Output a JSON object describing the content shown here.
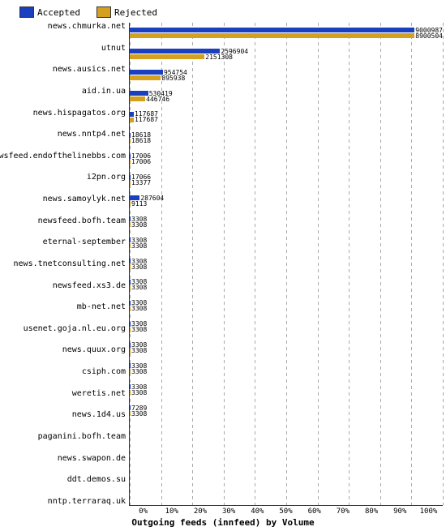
{
  "legend": {
    "accepted_label": "Accepted",
    "rejected_label": "Rejected"
  },
  "x_axis": {
    "title": "Outgoing feeds (innfeed) by Volume",
    "ticks": [
      "0%",
      "10%",
      "20%",
      "30%",
      "40%",
      "50%",
      "60%",
      "70%",
      "80%",
      "90%",
      "100%"
    ]
  },
  "max_value": 9000987,
  "bars": [
    {
      "label": "news.chmurka.net",
      "accepted": 9000987,
      "rejected": 8900504,
      "acc_pct": 100,
      "rej_pct": 98.8
    },
    {
      "label": "utnut",
      "accepted": 2596904,
      "rejected": 2151308,
      "acc_pct": 28.8,
      "rej_pct": 23.9
    },
    {
      "label": "news.ausics.net",
      "accepted": 954754,
      "rejected": 895938,
      "acc_pct": 10.6,
      "rej_pct": 9.95
    },
    {
      "label": "aid.in.ua",
      "accepted": 530419,
      "rejected": 446746,
      "acc_pct": 5.89,
      "rej_pct": 4.96
    },
    {
      "label": "news.hispagatos.org",
      "accepted": 117687,
      "rejected": 117687,
      "acc_pct": 1.31,
      "rej_pct": 1.31
    },
    {
      "label": "news.nntp4.net",
      "accepted": 18618,
      "rejected": 18618,
      "acc_pct": 0.207,
      "rej_pct": 0.207
    },
    {
      "label": "newsfeed.endofthelinebbs.com",
      "accepted": 17006,
      "rejected": 17006,
      "acc_pct": 0.189,
      "rej_pct": 0.189
    },
    {
      "label": "i2pn.org",
      "accepted": 17066,
      "rejected": 13377,
      "acc_pct": 0.19,
      "rej_pct": 0.149
    },
    {
      "label": "news.samoylyk.net",
      "accepted": 287604,
      "rejected": 9113,
      "acc_pct": 3.2,
      "rej_pct": 0.101
    },
    {
      "label": "newsfeed.bofh.team",
      "accepted": 3308,
      "rejected": 3308,
      "acc_pct": 0.0368,
      "rej_pct": 0.0368
    },
    {
      "label": "eternal-september",
      "accepted": 3308,
      "rejected": 3308,
      "acc_pct": 0.0368,
      "rej_pct": 0.0368
    },
    {
      "label": "news.tnetconsulting.net",
      "accepted": 3308,
      "rejected": 3308,
      "acc_pct": 0.0368,
      "rej_pct": 0.0368
    },
    {
      "label": "newsfeed.xs3.de",
      "accepted": 3308,
      "rejected": 3308,
      "acc_pct": 0.0368,
      "rej_pct": 0.0368
    },
    {
      "label": "mb-net.net",
      "accepted": 3308,
      "rejected": 3308,
      "acc_pct": 0.0368,
      "rej_pct": 0.0368
    },
    {
      "label": "usenet.goja.nl.eu.org",
      "accepted": 3308,
      "rejected": 3308,
      "acc_pct": 0.0368,
      "rej_pct": 0.0368
    },
    {
      "label": "news.quux.org",
      "accepted": 3308,
      "rejected": 3308,
      "acc_pct": 0.0368,
      "rej_pct": 0.0368
    },
    {
      "label": "csiph.com",
      "accepted": 3308,
      "rejected": 3308,
      "acc_pct": 0.0368,
      "rej_pct": 0.0368
    },
    {
      "label": "weretis.net",
      "accepted": 3308,
      "rejected": 3308,
      "acc_pct": 0.0368,
      "rej_pct": 0.0368
    },
    {
      "label": "news.1d4.us",
      "accepted": 7289,
      "rejected": 3308,
      "acc_pct": 0.081,
      "rej_pct": 0.0368
    },
    {
      "label": "paganini.bofh.team",
      "accepted": 0,
      "rejected": 0,
      "acc_pct": 0,
      "rej_pct": 0
    },
    {
      "label": "news.swapon.de",
      "accepted": 0,
      "rejected": 0,
      "acc_pct": 0,
      "rej_pct": 0
    },
    {
      "label": "ddt.demos.su",
      "accepted": 0,
      "rejected": 0,
      "acc_pct": 0,
      "rej_pct": 0
    },
    {
      "label": "nntp.terraraq.uk",
      "accepted": 0,
      "rejected": 0,
      "acc_pct": 0,
      "rej_pct": 0
    }
  ]
}
